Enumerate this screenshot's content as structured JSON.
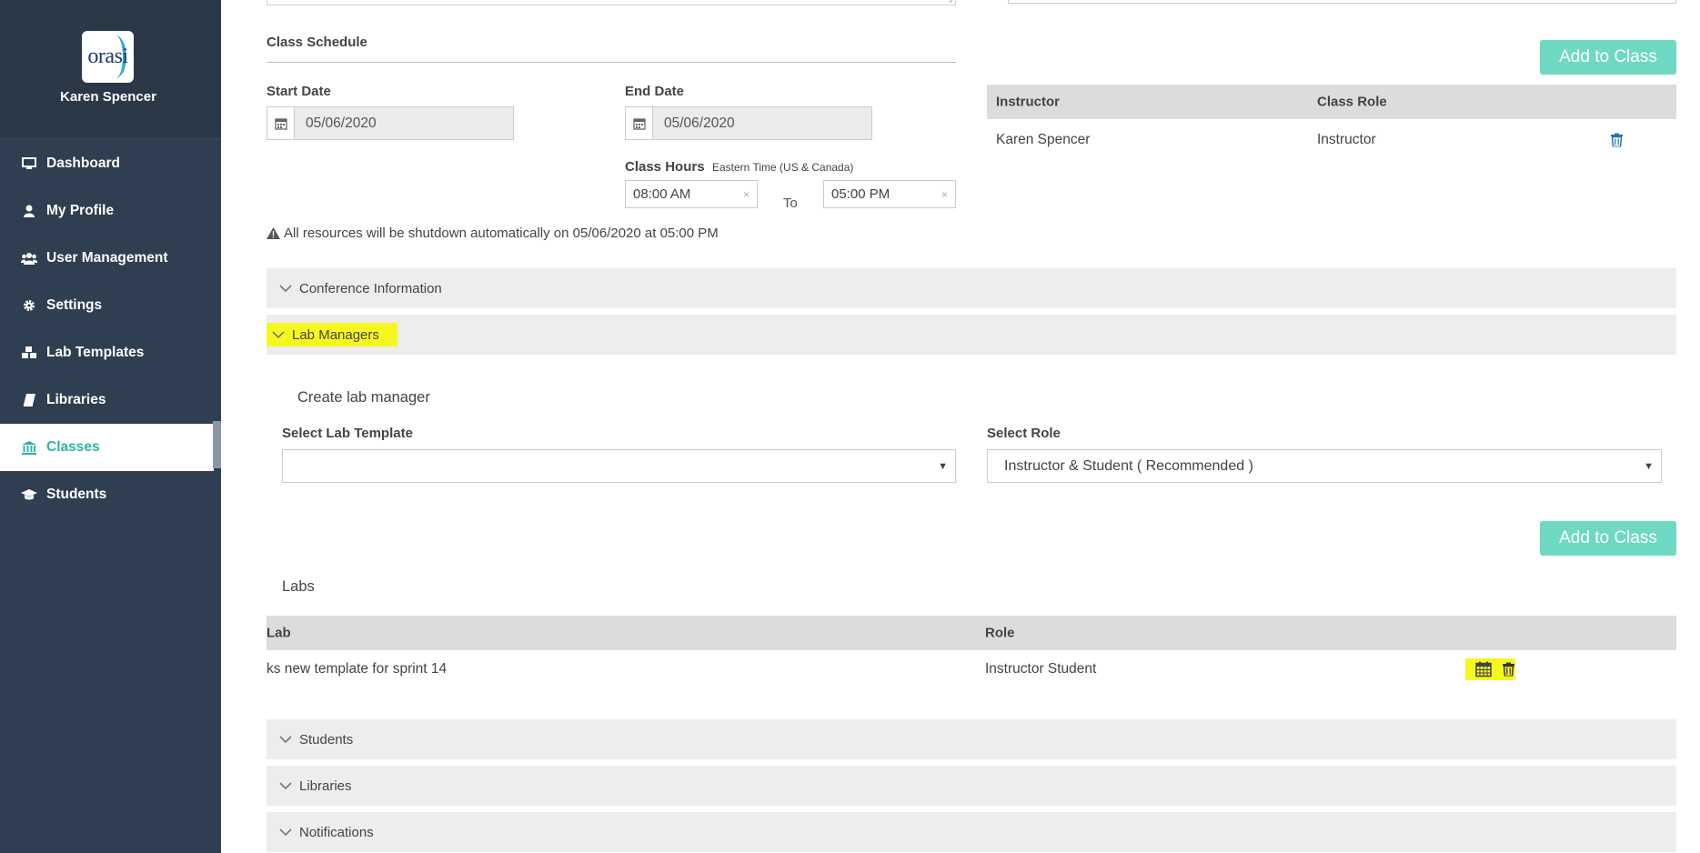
{
  "sidebar": {
    "user_name": "Karen Spencer",
    "logo_text": "orasi",
    "active_color": "#2cb5a0",
    "items": [
      {
        "label": "Dashboard",
        "icon": "monitor-icon"
      },
      {
        "label": "My Profile",
        "icon": "user-icon"
      },
      {
        "label": "User Management",
        "icon": "users-icon"
      },
      {
        "label": "Settings",
        "icon": "gear-icon"
      },
      {
        "label": "Lab Templates",
        "icon": "cubes-icon"
      },
      {
        "label": "Libraries",
        "icon": "book-icon"
      },
      {
        "label": "Classes",
        "icon": "bank-icon"
      },
      {
        "label": "Students",
        "icon": "graduation-cap-icon"
      }
    ]
  },
  "schedule": {
    "title": "Class Schedule",
    "start_label": "Start Date",
    "start_value": "05/06/2020",
    "end_label": "End Date",
    "end_value": "05/06/2020",
    "hours_label": "Class Hours",
    "timezone": "Eastern Time (US & Canada)",
    "from_time": "08:00 AM",
    "to_label": "To",
    "to_time": "05:00 PM",
    "clear_glyph": "×",
    "warning": "All resources will be shutdown automatically on 05/06/2020 at 05:00 PM"
  },
  "instructors": {
    "add_button": "Add to Class",
    "headers": [
      "Instructor",
      "Class Role"
    ],
    "rows": [
      {
        "name": "Karen Spencer",
        "role": "Instructor"
      }
    ]
  },
  "sections": {
    "conference": "Conference Information",
    "lab_managers": "Lab Managers",
    "students": "Students",
    "libraries": "Libraries",
    "notifications": "Notifications"
  },
  "lab_managers": {
    "create_title": "Create lab manager",
    "template_label": "Select Lab Template",
    "template_value": "",
    "role_label": "Select Role",
    "role_value": "Instructor & Student ( Recommended )",
    "add_button": "Add to Class",
    "labs_title": "Labs",
    "headers": [
      "Lab",
      "Role"
    ],
    "rows": [
      {
        "lab": "ks new template for sprint 14",
        "role": "Instructor Student"
      }
    ]
  },
  "colors": {
    "sidebar_bg": "#2f3e50",
    "accent_teal": "#6fd8c3",
    "highlight": "#f7f720",
    "delete_blue": "#2a6fb5"
  }
}
